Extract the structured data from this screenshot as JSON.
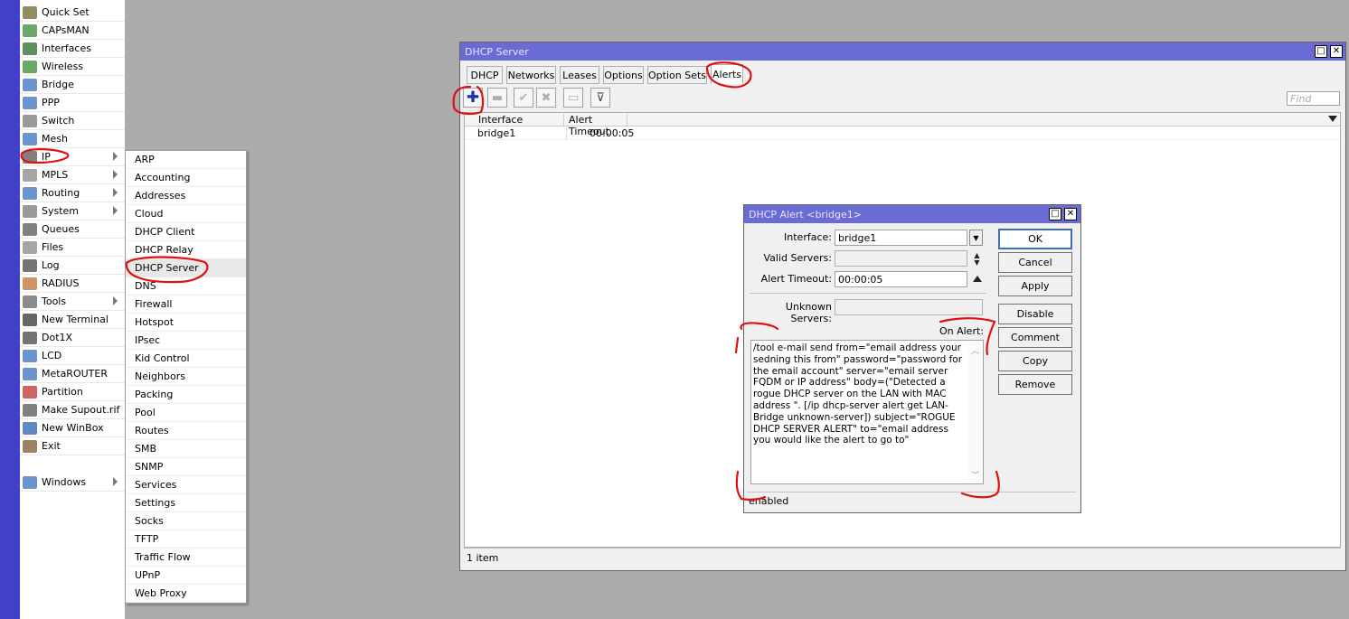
{
  "sidebar": {
    "items": [
      {
        "label": "Quick Set",
        "icon": "quick-set-icon",
        "submenu": false
      },
      {
        "label": "CAPsMAN",
        "icon": "capsman-icon",
        "submenu": false
      },
      {
        "label": "Interfaces",
        "icon": "interfaces-icon",
        "submenu": false
      },
      {
        "label": "Wireless",
        "icon": "wireless-icon",
        "submenu": false
      },
      {
        "label": "Bridge",
        "icon": "bridge-icon",
        "submenu": false
      },
      {
        "label": "PPP",
        "icon": "ppp-icon",
        "submenu": false
      },
      {
        "label": "Switch",
        "icon": "switch-icon",
        "submenu": false
      },
      {
        "label": "Mesh",
        "icon": "mesh-icon",
        "submenu": false
      },
      {
        "label": "IP",
        "icon": "ip-icon",
        "submenu": true
      },
      {
        "label": "MPLS",
        "icon": "mpls-icon",
        "submenu": true
      },
      {
        "label": "Routing",
        "icon": "routing-icon",
        "submenu": true
      },
      {
        "label": "System",
        "icon": "system-icon",
        "submenu": true
      },
      {
        "label": "Queues",
        "icon": "queues-icon",
        "submenu": false
      },
      {
        "label": "Files",
        "icon": "files-icon",
        "submenu": false
      },
      {
        "label": "Log",
        "icon": "log-icon",
        "submenu": false
      },
      {
        "label": "RADIUS",
        "icon": "radius-icon",
        "submenu": false
      },
      {
        "label": "Tools",
        "icon": "tools-icon",
        "submenu": true
      },
      {
        "label": "New Terminal",
        "icon": "terminal-icon",
        "submenu": false
      },
      {
        "label": "Dot1X",
        "icon": "dot1x-icon",
        "submenu": false
      },
      {
        "label": "LCD",
        "icon": "lcd-icon",
        "submenu": false
      },
      {
        "label": "MetaROUTER",
        "icon": "metarouter-icon",
        "submenu": false
      },
      {
        "label": "Partition",
        "icon": "partition-icon",
        "submenu": false
      },
      {
        "label": "Make Supout.rif",
        "icon": "supout-icon",
        "submenu": false
      },
      {
        "label": "New WinBox",
        "icon": "winbox-icon",
        "submenu": false
      },
      {
        "label": "Exit",
        "icon": "exit-icon",
        "submenu": false
      },
      {
        "label": "",
        "icon": "",
        "submenu": false
      },
      {
        "label": "Windows",
        "icon": "windows-icon",
        "submenu": true
      }
    ]
  },
  "ip_submenu": {
    "items": [
      "ARP",
      "Accounting",
      "Addresses",
      "Cloud",
      "DHCP Client",
      "DHCP Relay",
      "DHCP Server",
      "DNS",
      "Firewall",
      "Hotspot",
      "IPsec",
      "Kid Control",
      "Neighbors",
      "Packing",
      "Pool",
      "Routes",
      "SMB",
      "SNMP",
      "Services",
      "Settings",
      "Socks",
      "TFTP",
      "Traffic Flow",
      "UPnP",
      "Web Proxy"
    ]
  },
  "dhcp_window": {
    "title": "DHCP Server",
    "tabs": [
      "DHCP",
      "Networks",
      "Leases",
      "Options",
      "Option Sets",
      "Alerts"
    ],
    "active_tab": "Alerts",
    "find_placeholder": "Find",
    "columns": [
      "Interface",
      "Alert Timeout"
    ],
    "rows": [
      [
        "bridge1",
        "00:00:05"
      ]
    ],
    "status": "1 item"
  },
  "alert_dialog": {
    "title": "DHCP Alert <bridge1>",
    "interface_label": "Interface:",
    "interface_value": "bridge1",
    "valid_servers_label": "Valid Servers:",
    "valid_servers_value": "",
    "alert_timeout_label": "Alert Timeout:",
    "alert_timeout_value": "00:00:05",
    "unknown_servers_label": "Unknown Servers:",
    "unknown_servers_value": "",
    "on_alert_label": "On Alert:",
    "on_alert_script": "/tool e-mail send from=\"email address your sedning this from\" password=\"password for the email account\" server=\"email server FQDM or IP address\" body=(\"Detected a rogue DHCP server on the LAN with MAC address \". [/ip dhcp-server alert get LAN-Bridge unknown-server]) subject=\"ROGUE DHCP SERVER ALERT\" to=\"email address you would like the alert to go to\"",
    "status": "enabled",
    "buttons": {
      "ok": "OK",
      "cancel": "Cancel",
      "apply": "Apply",
      "disable": "Disable",
      "comment": "Comment",
      "copy": "Copy",
      "remove": "Remove"
    }
  },
  "colors": {
    "taskbar": "#4040c8",
    "titlebar": "#6b6bd6",
    "desktop": "#ababab",
    "annotation": "#e01010",
    "add_icon": "#2233aa"
  }
}
